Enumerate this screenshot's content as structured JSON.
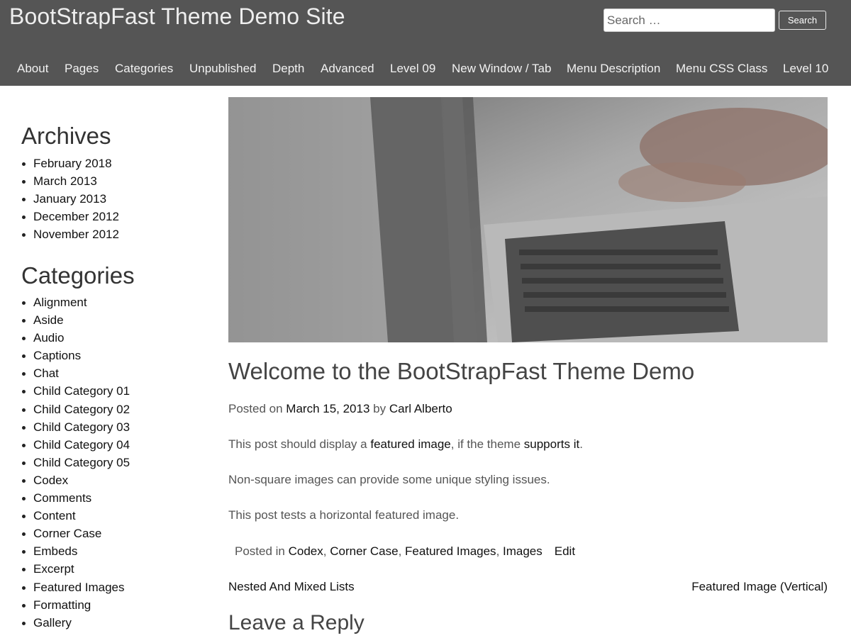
{
  "site": {
    "title": "BootStrapFast Theme Demo Site"
  },
  "search": {
    "placeholder": "Search …",
    "button_label": "Search"
  },
  "nav": {
    "items": [
      "About",
      "Pages",
      "Categories",
      "Unpublished",
      "Depth",
      "Advanced",
      "Level 09",
      "New Window / Tab",
      "Menu Description",
      "Menu CSS Class",
      "Level 10"
    ]
  },
  "sidebar": {
    "archives": {
      "title": "Archives",
      "items": [
        "February 2018",
        "March 2013",
        "January 2013",
        "December 2012",
        "November 2012"
      ]
    },
    "categories": {
      "title": "Categories",
      "items": [
        "Alignment",
        "Aside",
        "Audio",
        "Captions",
        "Chat",
        "Child Category 01",
        "Child Category 02",
        "Child Category 03",
        "Child Category 04",
        "Child Category 05",
        "Codex",
        "Comments",
        "Content",
        "Corner Case",
        "Embeds",
        "Excerpt",
        "Featured Images",
        "Formatting",
        "Gallery"
      ]
    }
  },
  "post": {
    "title": "Welcome to the BootStrapFast Theme Demo",
    "meta": {
      "posted_on_label": "Posted on",
      "date": "March 15, 2013",
      "by_label": "by",
      "author": "Carl Alberto"
    },
    "paragraph1": {
      "text_before": "This post should display a",
      "link1": "featured image",
      "text_middle": ", if the theme",
      "link2": "supports it",
      "text_after": "."
    },
    "paragraph2": "Non-square images can provide some unique styling issues.",
    "paragraph3": "This post tests a horizontal featured image.",
    "footer": {
      "posted_in_label": "Posted in",
      "categories": [
        "Codex",
        "Corner Case",
        "Featured Images",
        "Images"
      ],
      "edit_label": "Edit"
    }
  },
  "post_navigation": {
    "previous": "Nested And Mixed Lists",
    "next": "Featured Image (Vertical)"
  },
  "comments": {
    "reply_title": "Leave a Reply"
  }
}
